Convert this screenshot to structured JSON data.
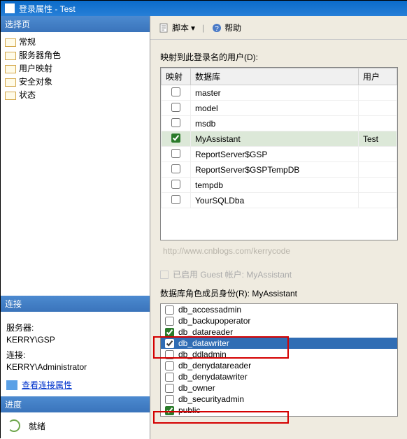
{
  "title": "登录属性 - Test",
  "section_select": "选择页",
  "nav": {
    "items": [
      {
        "label": "常规"
      },
      {
        "label": "服务器角色"
      },
      {
        "label": "用户映射"
      },
      {
        "label": "安全对象"
      },
      {
        "label": "状态"
      }
    ]
  },
  "toolbar": {
    "script": "脚本",
    "help": "帮助"
  },
  "map_label": "映射到此登录名的用户(D):",
  "table": {
    "headers": {
      "map": "映射",
      "db": "数据库",
      "user": "用户"
    },
    "rows": [
      {
        "checked": false,
        "db": "master",
        "user": ""
      },
      {
        "checked": false,
        "db": "model",
        "user": ""
      },
      {
        "checked": false,
        "db": "msdb",
        "user": ""
      },
      {
        "checked": true,
        "db": "MyAssistant",
        "user": "Test",
        "selected": true
      },
      {
        "checked": false,
        "db": "ReportServer$GSP",
        "user": ""
      },
      {
        "checked": false,
        "db": "ReportServer$GSPTempDB",
        "user": ""
      },
      {
        "checked": false,
        "db": "tempdb",
        "user": ""
      },
      {
        "checked": false,
        "db": "YourSQLDba",
        "user": ""
      }
    ]
  },
  "watermark": "http://www.cnblogs.com/kerrycode",
  "guest": "已启用 Guest 帐户: MyAssistant",
  "roles_label": "数据库角色成员身份(R): MyAssistant",
  "roles": [
    {
      "checked": false,
      "name": "db_accessadmin"
    },
    {
      "checked": false,
      "name": "db_backupoperator"
    },
    {
      "checked": true,
      "name": "db_datareader"
    },
    {
      "checked": true,
      "name": "db_datawriter",
      "selected": true
    },
    {
      "checked": false,
      "name": "db_ddladmin"
    },
    {
      "checked": false,
      "name": "db_denydatareader"
    },
    {
      "checked": false,
      "name": "db_denydatawriter"
    },
    {
      "checked": false,
      "name": "db_owner"
    },
    {
      "checked": false,
      "name": "db_securityadmin"
    },
    {
      "checked": true,
      "name": "public"
    }
  ],
  "conn": {
    "header": "连接",
    "server_label": "服务器:",
    "server": "KERRY\\GSP",
    "conn_label": "连接:",
    "conn": "KERRY\\Administrator",
    "view_props": "查看连接属性"
  },
  "progress": {
    "header": "进度",
    "status": "就绪"
  }
}
